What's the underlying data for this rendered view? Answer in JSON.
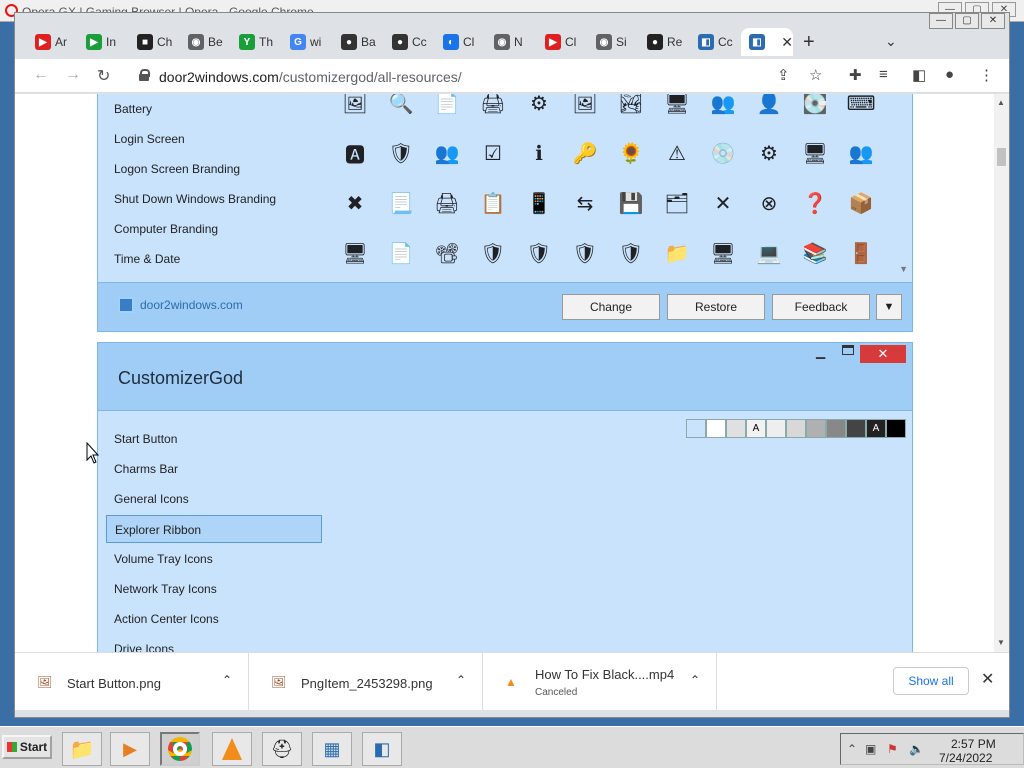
{
  "background_window": {
    "title": "Opera GX | Gaming Browser | Opera - Google Chrome"
  },
  "tabs": [
    {
      "label": "Ar",
      "color": "#e02020",
      "glyph": "▶"
    },
    {
      "label": "In",
      "color": "#1a9e3a",
      "glyph": "▶"
    },
    {
      "label": "Ch",
      "color": "#222222",
      "glyph": "■"
    },
    {
      "label": "Be",
      "color": "#5f6368",
      "glyph": "◉"
    },
    {
      "label": "Th",
      "color": "#1a9e3a",
      "glyph": "Y"
    },
    {
      "label": "wi",
      "color": "#4285f4",
      "glyph": "G"
    },
    {
      "label": "Ba",
      "color": "#333333",
      "glyph": "●"
    },
    {
      "label": "Cc",
      "color": "#333333",
      "glyph": "●"
    },
    {
      "label": "Cl",
      "color": "#1a73e8",
      "glyph": "◐"
    },
    {
      "label": "N",
      "color": "#5f6368",
      "glyph": "◉"
    },
    {
      "label": "Cl",
      "color": "#e02020",
      "glyph": "▶"
    },
    {
      "label": "Si",
      "color": "#5f6368",
      "glyph": "◉"
    },
    {
      "label": "Re",
      "color": "#222222",
      "glyph": "●"
    },
    {
      "label": "Cc",
      "color": "#2b6cb0",
      "glyph": "◧"
    },
    {
      "label": "",
      "color": "#2b6cb0",
      "glyph": "◧",
      "active": true
    }
  ],
  "address": {
    "domain": "door2windows.com",
    "path": "/customizergod/all-resources/"
  },
  "resources": [
    "Battery",
    "Login Screen",
    "Logon Screen Branding",
    "Shut Down Windows Branding",
    "Computer Branding",
    "Time & Date"
  ],
  "icon_rows": [
    [
      "🖼",
      "🔍",
      "📄",
      "🖨",
      "⚙",
      "🖼",
      "🏞",
      "🖥",
      "👥",
      "👤",
      "💽",
      "⌨"
    ],
    [
      "🅰",
      "🛡",
      "👥",
      "☑",
      "ℹ",
      "🔑",
      "🌻",
      "⚠",
      "💿",
      "⚙",
      "🖥",
      "👥"
    ],
    [
      "✖",
      "📃",
      "🖨",
      "📋",
      "📱",
      "⇆",
      "💾",
      "🗂",
      "✕",
      "⊗",
      "❓",
      "📦"
    ],
    [
      "🖥",
      "📄",
      "📽",
      "🛡",
      "🛡",
      "🛡",
      "🛡",
      "📁",
      "🖥",
      "💻",
      "📚",
      "🚪"
    ]
  ],
  "panel1_footer": {
    "brand": "door2windows.com",
    "change": "Change",
    "restore": "Restore",
    "feedback": "Feedback",
    "dropdown": "▼"
  },
  "panel2": {
    "title": "CustomizerGod",
    "categories": [
      "Start Button",
      "Charms Bar",
      "General Icons",
      "Explorer Ribbon",
      "Volume Tray Icons",
      "Network Tray Icons",
      "Action Center Icons",
      "Drive Icons"
    ],
    "selected": "Explorer Ribbon",
    "swatches": [
      {
        "bg": "#c9e3fd",
        "t": ""
      },
      {
        "bg": "#ffffff",
        "t": ""
      },
      {
        "bg": "#e0e0e0",
        "t": ""
      },
      {
        "bg": "#f2f2f2",
        "t": "A"
      },
      {
        "bg": "#eeeeee",
        "t": ""
      },
      {
        "bg": "#d8d8d8",
        "t": ""
      },
      {
        "bg": "#b0b0b0",
        "t": ""
      },
      {
        "bg": "#888888",
        "t": ""
      },
      {
        "bg": "#444444",
        "t": ""
      },
      {
        "bg": "#222222",
        "t": "A"
      },
      {
        "bg": "#000000",
        "t": ""
      }
    ]
  },
  "downloads": [
    {
      "name": "Start Button.png",
      "status": ""
    },
    {
      "name": "PngItem_2453298.png",
      "status": ""
    },
    {
      "name": "How To Fix Black....mp4",
      "status": "Canceled"
    }
  ],
  "show_all": "Show all",
  "taskbar": {
    "start": "Start",
    "time": "2:57 PM",
    "date": "7/24/2022"
  }
}
